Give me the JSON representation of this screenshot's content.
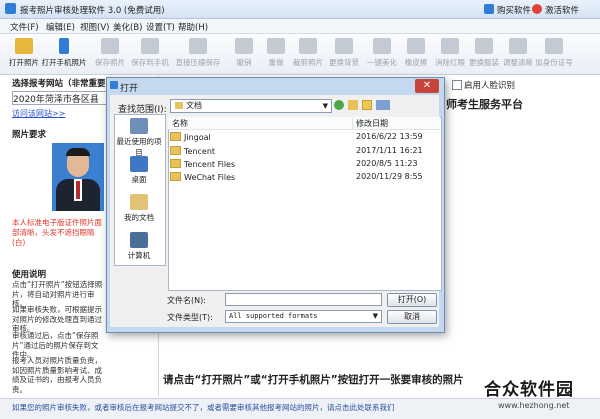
{
  "titlebar": {
    "title": "报考照片审核处理软件 3.0 (免费试用)",
    "buy": "购买软件",
    "activate": "激活软件"
  },
  "menu": [
    "文件(F)",
    "编辑(E)",
    "视图(V)",
    "美化(B)",
    "设置(T)",
    "帮助(H)"
  ],
  "toolbar": [
    {
      "label": "打开照片",
      "icon": "folder-open-icon",
      "enabled": true
    },
    {
      "label": "打开手机照片",
      "icon": "phone-icon",
      "enabled": true
    },
    {
      "label": "保存照片",
      "icon": "save-icon",
      "enabled": false
    },
    {
      "label": "保存到手机",
      "icon": "save-phone-icon",
      "enabled": false
    },
    {
      "label": "直接压缩保存",
      "icon": "compress-icon",
      "enabled": false
    },
    {
      "label": "撤销",
      "icon": "undo-icon",
      "enabled": false
    },
    {
      "label": "重做",
      "icon": "redo-icon",
      "enabled": false
    },
    {
      "label": "裁剪照片",
      "icon": "crop-icon",
      "enabled": false
    },
    {
      "label": "更换背景",
      "icon": "background-icon",
      "enabled": false
    },
    {
      "label": "一键美化",
      "icon": "beautify-icon",
      "enabled": false
    },
    {
      "label": "橡皮擦",
      "icon": "eraser-icon",
      "enabled": false
    },
    {
      "label": "消除红眼",
      "icon": "redeye-icon",
      "enabled": false
    },
    {
      "label": "更换服装",
      "icon": "clothes-icon",
      "enabled": false
    },
    {
      "label": "调整清晰",
      "icon": "sharpen-icon",
      "enabled": false
    },
    {
      "label": "加身份证号",
      "icon": "id-icon",
      "enabled": false
    }
  ],
  "left": {
    "site_label": "选择报考网站（非常重要",
    "site_value": "2020年菏泽市各区县",
    "visit_link": "访问该网站>>",
    "photo_req": "照片要求",
    "photo_note": "本人标准电子版证件照片面部清晰，头发不遮挡眼睛(白)",
    "usage_title": "使用说明",
    "usage": [
      "点击“打开照片”按钮选择照片，将自动对照片进行审核。",
      "如果审核失败，可根据提示对照片的修改处理直到通过审核。",
      "审核通过后，点击“保存照片”通过后的照片保存到文件中。",
      "报考人员对照片质量负责，如因照片质量影响考试、成绩及证书的，由报考人员负责。"
    ]
  },
  "right": {
    "face_check": "启用人脸识别",
    "platform": "师考生服务平台",
    "instruction": "请点击“打开照片”或“打开手机照片”按钮打开一张要审核的照片"
  },
  "status": "如果您的照片审核失败，或者审核后在报考网站提交不了，或者需要审核其他报考网站的照片，请点击此处联系我们",
  "watermark": {
    "text": "合众软件园",
    "url": "www.hezhong.net"
  },
  "dialog": {
    "title": "打开",
    "look_in_label": "查找范围(I):",
    "look_in_value": "文档",
    "places": [
      "最近使用的项目",
      "桌面",
      "我的文档",
      "计算机"
    ],
    "columns": {
      "name": "名称",
      "date": "修改日期"
    },
    "files": [
      {
        "name": "Jingoal",
        "date": "2016/6/22 13:59"
      },
      {
        "name": "Tencent",
        "date": "2017/1/11 16:21"
      },
      {
        "name": "Tencent Files",
        "date": "2020/8/5 11:23"
      },
      {
        "name": "WeChat Files",
        "date": "2020/11/29 8:55"
      }
    ],
    "filename_label": "文件名(N):",
    "filetype_label": "文件类型(T):",
    "filetype_value": "All supported formats",
    "open_btn": "打开(O)",
    "cancel_btn": "取消"
  }
}
